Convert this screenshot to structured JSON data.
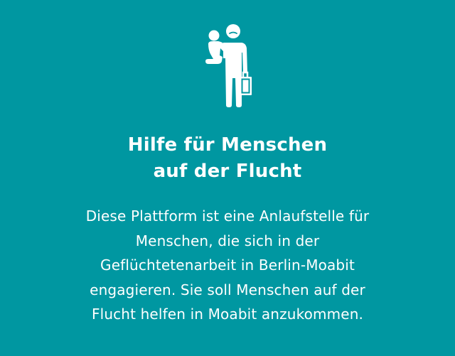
{
  "icon": {
    "name": "refugee-parent-with-child-icon"
  },
  "colors": {
    "background": "#0097a1",
    "foreground": "#ffffff"
  },
  "heading": {
    "lines": [
      "Hilfe für Menschen",
      "auf der Flucht"
    ]
  },
  "description": {
    "lines": [
      "Diese Plattform ist eine Anlaufstelle für",
      "Menschen, die sich in der",
      "Geflüchtetenarbeit in Berlin-Moabit",
      "engagieren. Sie soll Menschen auf der",
      "Flucht helfen in Moabit anzukommen."
    ]
  }
}
